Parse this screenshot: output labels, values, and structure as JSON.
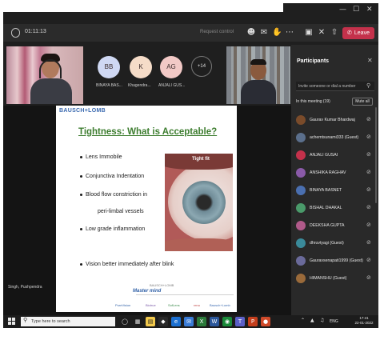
{
  "window": {
    "controls": [
      "—",
      "☐",
      "✕"
    ]
  },
  "toolbar": {
    "timer": "01:11:13",
    "request_control": "Request control",
    "leave_label": "Leave"
  },
  "video_strip": {
    "participants": [
      {
        "initials": "BB",
        "label": "BINAYA BAS...",
        "color": "#cfd8f3"
      },
      {
        "initials": "K",
        "label": "Khagendra...",
        "color": "#f5dcc8"
      },
      {
        "initials": "AG",
        "label": "ANJALI GUS...",
        "color": "#f2c9c6"
      }
    ],
    "more_count": "+14"
  },
  "slide": {
    "brand": "BAUSCH+LOMB",
    "title": "Tightness: What is Acceptable?",
    "bullets": [
      "Lens Immobile",
      "Conjunctiva Indentation",
      "Blood flow constriction in",
      "peri-limbal vessels",
      "Low grade inflammation",
      "Vision better immediately after blink"
    ],
    "image_caption": "Tight fit",
    "footer_logo_small": "BAUSCH+LOMB",
    "footer_logo": "Master mind",
    "footer_brands": [
      "PureVision",
      "Biotrue",
      "SofLens",
      "renu",
      "Bausch+Lomb"
    ]
  },
  "presenter_name": "Singh, Pushpendra",
  "participants_panel": {
    "title": "Participants",
    "invite_placeholder": "Invite someone or dial a number",
    "in_meeting": "In this meeting (19)",
    "mute_all": "Mute all",
    "people": [
      {
        "name": "Gaurav Kumar Bhardwaj",
        "color": "#7a4b2a"
      },
      {
        "name": "achemtsunami333 (Guest)",
        "color": "#5b6f8c"
      },
      {
        "name": "ANJALI GUSAI",
        "color": "#c4314b"
      },
      {
        "name": "ANSHIKA RAGHAV",
        "color": "#8a5aa8"
      },
      {
        "name": "BINAYA BASNET",
        "color": "#4a6fb0"
      },
      {
        "name": "BISHAL DHAKAL",
        "color": "#4a9a6a"
      },
      {
        "name": "DEEKSHA GUPTA",
        "color": "#b05a8a"
      },
      {
        "name": "dhruvtyagi (Guest)",
        "color": "#3a8a9a"
      },
      {
        "name": "Gauravsenapati1999 (Guest)",
        "color": "#6a6a9a"
      },
      {
        "name": "HIMANSHU (Guest)",
        "color": "#9a6a3a"
      }
    ]
  },
  "taskbar": {
    "search_placeholder": "Type here to search",
    "tray_lang": "ENG",
    "time": "17:41",
    "date": "22-01-2022"
  }
}
